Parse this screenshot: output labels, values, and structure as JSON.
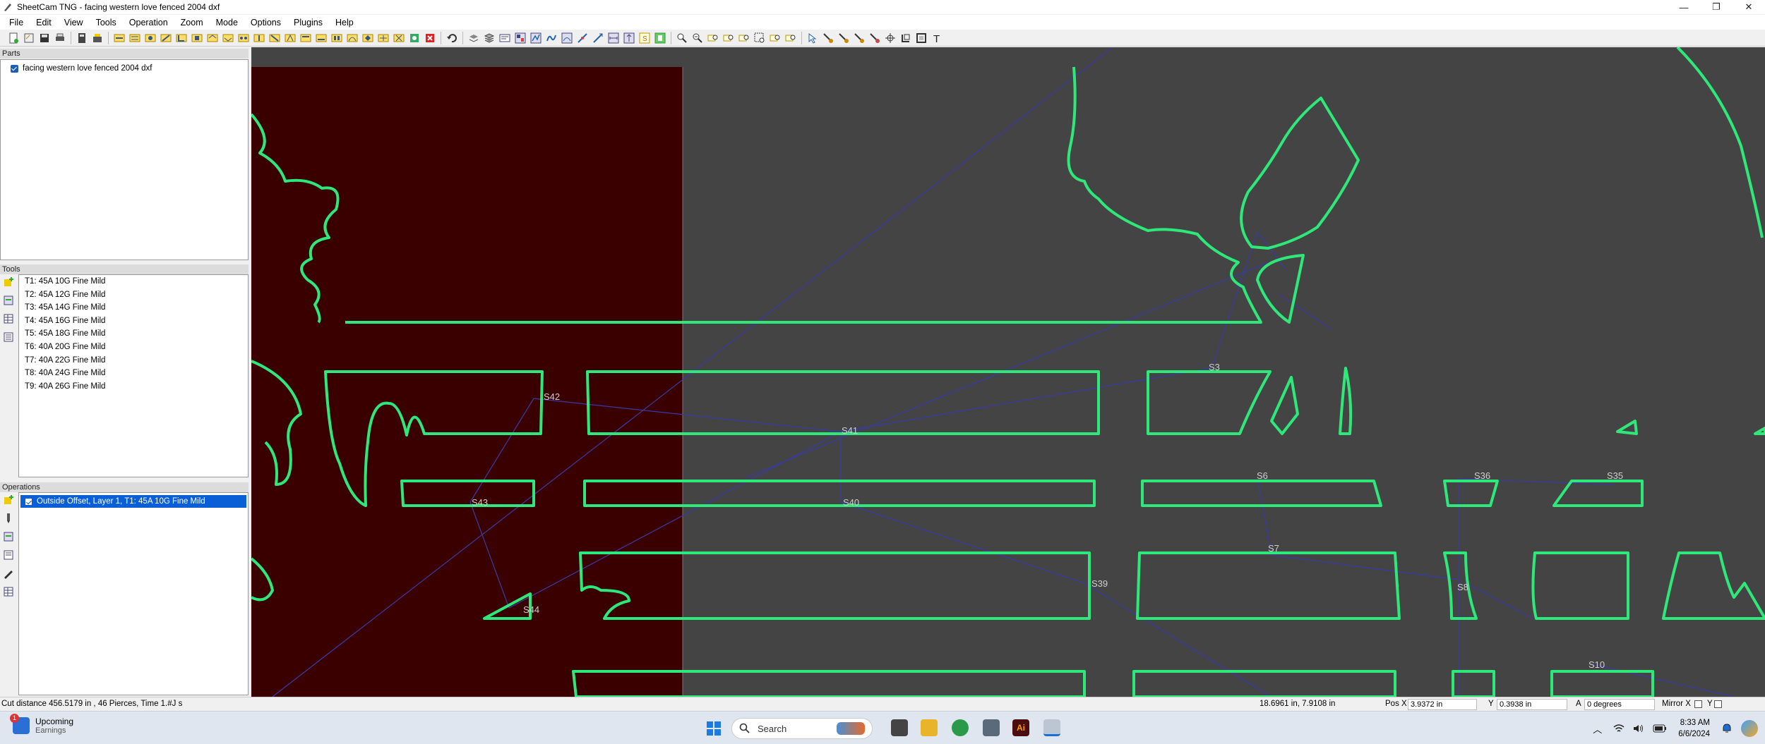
{
  "window": {
    "title": "SheetCam TNG - facing western love fenced 2004 dxf"
  },
  "menu": [
    "File",
    "Edit",
    "View",
    "Tools",
    "Operation",
    "Zoom",
    "Mode",
    "Options",
    "Plugins",
    "Help"
  ],
  "parts": {
    "header": "Parts",
    "items": [
      {
        "label": "facing western love fenced 2004 dxf",
        "checked": true
      }
    ]
  },
  "tools": {
    "header": "Tools",
    "items": [
      "T1: 45A 10G Fine Mild",
      "T2: 45A 12G Fine Mild",
      "T3: 45A 14G Fine Mild",
      "T4: 45A 16G Fine Mild",
      "T5: 45A 18G Fine Mild",
      "T6: 40A 20G Fine Mild",
      "T7: 40A 22G Fine Mild",
      "T8: 40A 24G Fine Mild",
      "T9: 40A 26G Fine Mild"
    ]
  },
  "operations": {
    "header": "Operations",
    "items": [
      {
        "label": "Outside Offset, Layer 1, T1: 45A 10G Fine Mild",
        "checked": true,
        "selected": true
      }
    ]
  },
  "canvas": {
    "colors": {
      "background": "#444444",
      "sheet": "#3a0000",
      "path": "#2ee87a",
      "rapid": "#3a3aa8"
    },
    "labels": [
      "S42",
      "S41",
      "S43",
      "S40",
      "S44",
      "S3",
      "S6",
      "S36",
      "S35",
      "S7",
      "S39",
      "S10",
      "S8"
    ]
  },
  "status": {
    "cut_info": "Cut distance 456.5179 in , 46 Pierces, Time 1.#J s",
    "cursor": "18.6961 in, 7.9108 in",
    "pos_x_label": "Pos X",
    "pos_x": "3.9372 in",
    "y_label": "Y",
    "y": "0.3938 in",
    "a_label": "A",
    "a": "0 degrees",
    "mirror_x_label": "Mirror X",
    "mirror_y_label": "Y"
  },
  "taskbar": {
    "widget_title": "Upcoming",
    "widget_sub": "Earnings",
    "widget_badge": "1",
    "search_placeholder": "Search",
    "time": "8:33 AM",
    "date": "6/6/2024"
  },
  "window_buttons": [
    "—",
    "❐",
    "✕"
  ],
  "icons": [
    "app-icon",
    "search-icon",
    "windows-start-icon",
    "wifi-icon",
    "volume-icon",
    "battery-icon",
    "notification-icon"
  ]
}
